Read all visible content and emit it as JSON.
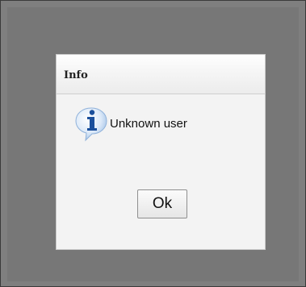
{
  "dialog": {
    "title": "Info",
    "message": "Unknown user",
    "icon": "info-icon",
    "ok_label": "Ok"
  },
  "colors": {
    "overlay": "#777777",
    "dialog_background": "#f3f3f3",
    "icon_blue": "#1a4f9c"
  }
}
